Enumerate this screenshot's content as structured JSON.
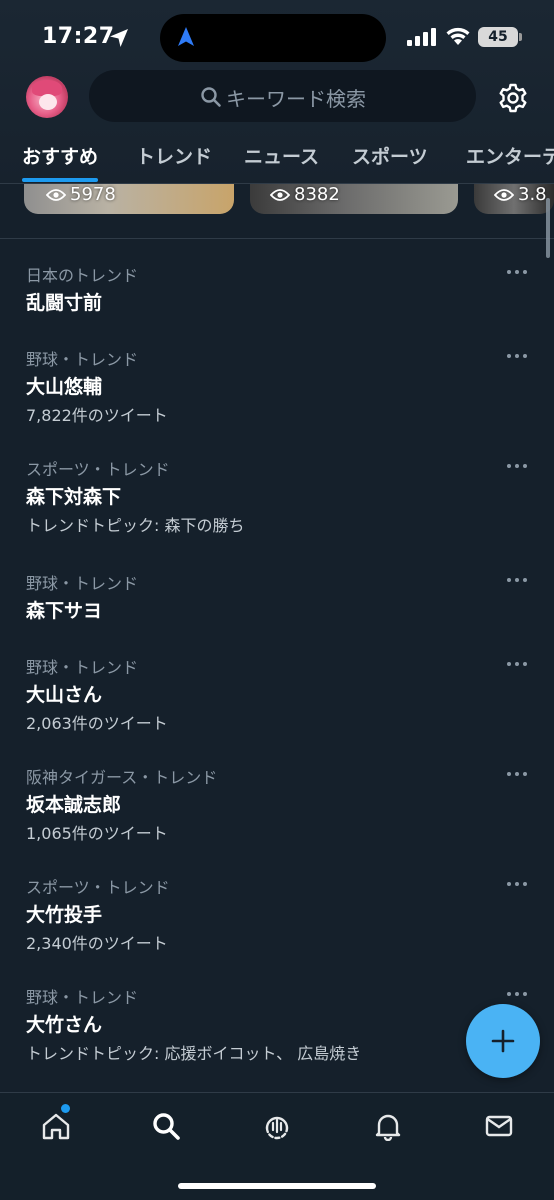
{
  "status_bar": {
    "time": "17:27",
    "battery": "45"
  },
  "header": {
    "search_placeholder": "キーワード検索"
  },
  "tabs": [
    {
      "label": "おすすめ",
      "active": true
    },
    {
      "label": "トレンド",
      "active": false
    },
    {
      "label": "ニュース",
      "active": false
    },
    {
      "label": "スポーツ",
      "active": false
    },
    {
      "label": "エンターテ",
      "active": false
    }
  ],
  "carousel": [
    {
      "views": "5978"
    },
    {
      "views": "8382"
    },
    {
      "views": "3.8"
    }
  ],
  "trends": [
    {
      "category": "日本のトレンド",
      "name": "乱闘寸前",
      "sub": ""
    },
    {
      "category": "野球・トレンド",
      "name": "大山悠輔",
      "sub": "7,822件のツイート"
    },
    {
      "category": "スポーツ・トレンド",
      "name": "森下対森下",
      "sub": "トレンドトピック: 森下の勝ち"
    },
    {
      "category": "野球・トレンド",
      "name": "森下サヨ",
      "sub": ""
    },
    {
      "category": "野球・トレンド",
      "name": "大山さん",
      "sub": "2,063件のツイート"
    },
    {
      "category": "阪神タイガース・トレンド",
      "name": "坂本誠志郎",
      "sub": "1,065件のツイート"
    },
    {
      "category": "スポーツ・トレンド",
      "name": "大竹投手",
      "sub": "2,340件のツイート"
    },
    {
      "category": "野球・トレンド",
      "name": "大竹さん",
      "sub": "トレンドトピック: 応援ボイコット、 広島焼き"
    }
  ],
  "bottom_nav": [
    {
      "icon": "home-icon",
      "has_notification_dot": true
    },
    {
      "icon": "search-icon",
      "active": true
    },
    {
      "icon": "spaces-icon"
    },
    {
      "icon": "bell-icon"
    },
    {
      "icon": "mail-icon"
    }
  ],
  "colors": {
    "background": "#15202b",
    "accent": "#1d9bf0",
    "fab": "#4ab3f4",
    "secondary_text": "#8b98a5"
  }
}
